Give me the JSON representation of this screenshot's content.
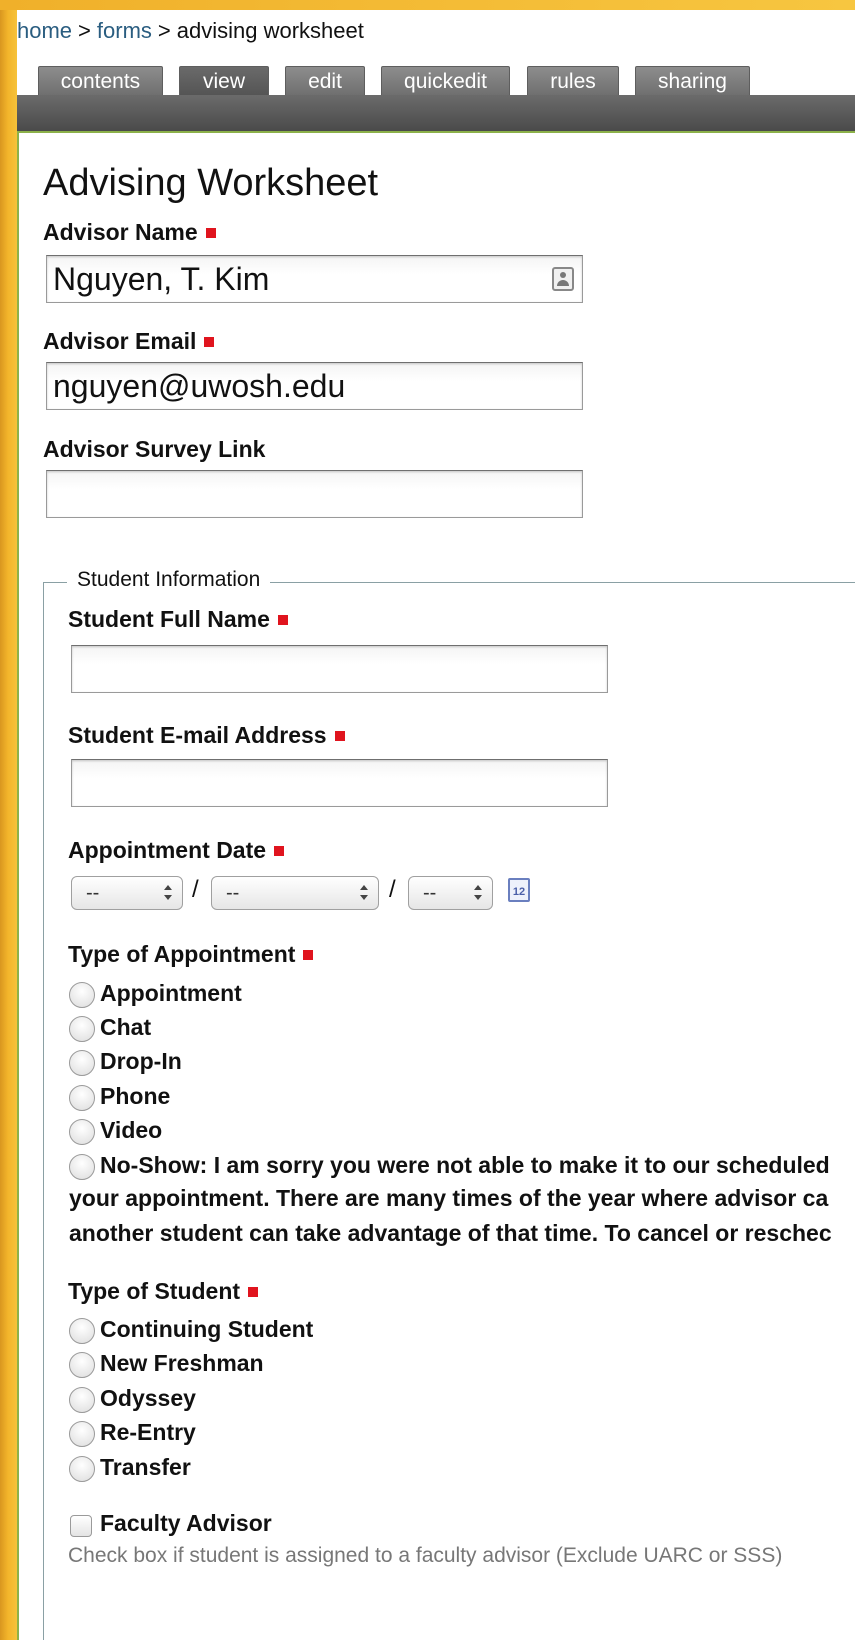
{
  "breadcrumb": {
    "home": "home",
    "forms": "forms",
    "current": "advising worksheet",
    "separator": ">"
  },
  "tabs": [
    {
      "label": "contents"
    },
    {
      "label": "view"
    },
    {
      "label": "edit"
    },
    {
      "label": "quickedit"
    },
    {
      "label": "rules"
    },
    {
      "label": "sharing"
    }
  ],
  "active_tab": "view",
  "form": {
    "title": "Advising Worksheet",
    "advisor_name": {
      "label": "Advisor Name",
      "value": "Nguyen, T. Kim"
    },
    "advisor_email": {
      "label": "Advisor Email",
      "value": "nguyen@uwosh.edu"
    },
    "advisor_survey_link": {
      "label": "Advisor Survey Link",
      "value": ""
    }
  },
  "student_info": {
    "legend": "Student Information",
    "full_name": {
      "label": "Student Full Name",
      "value": ""
    },
    "email": {
      "label": "Student E-mail Address",
      "value": ""
    },
    "appointment_date": {
      "label": "Appointment Date",
      "month": "--",
      "day": "--",
      "year": "--",
      "separator": "/",
      "calendar_icon_text": "12"
    },
    "appointment_type": {
      "label": "Type of Appointment",
      "options": [
        "Appointment",
        "Chat",
        "Drop-In",
        "Phone",
        "Video"
      ],
      "no_show_lines": [
        "No-Show: I am sorry you were not able to make it to our scheduled",
        "your appointment. There are many times of the year where advisor ca",
        "another student can take advantage of that time. To cancel or reschec"
      ]
    },
    "student_type": {
      "label": "Type of Student",
      "options": [
        "Continuing Student",
        "New Freshman",
        "Odyssey",
        "Re-Entry",
        "Transfer"
      ]
    },
    "faculty_advisor": {
      "label": "Faculty Advisor",
      "help": "Check box if student is assigned to a faculty advisor (Exclude UARC or SSS)"
    }
  },
  "colors": {
    "accent_yellow": "#f6c23a",
    "required_marker": "#e0141e",
    "tab_bar": "#5a5a5a",
    "green_rule": "#8cb14a",
    "link": "#2a5d80"
  },
  "icons": {
    "contact_icon": "address-book-icon",
    "calendar_icon": "calendar-icon"
  }
}
